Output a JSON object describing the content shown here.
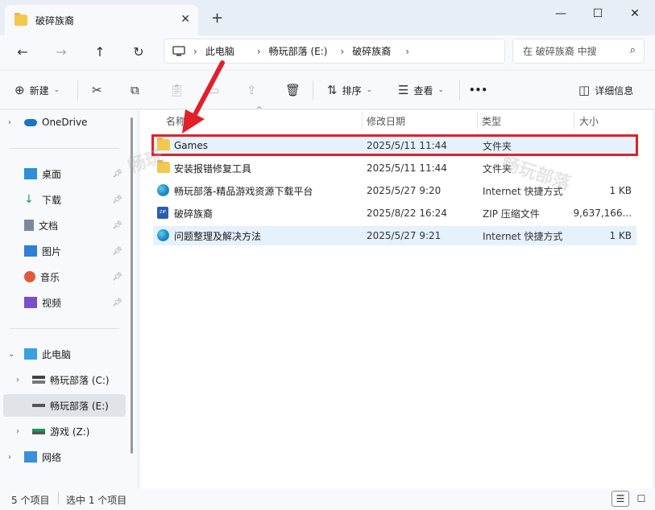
{
  "window": {
    "tab_title": "破碎族裔",
    "tab_close": "✕",
    "new_tab": "+",
    "minimize": "—",
    "maximize": "☐",
    "close": "✕"
  },
  "address": {
    "crumbs": [
      "此电脑",
      "畅玩部落 (E:)",
      "破碎族裔"
    ],
    "search_placeholder": "在 破碎族裔 中搜"
  },
  "toolbar": {
    "new_label": "新建",
    "sort_label": "排序",
    "view_label": "查看",
    "more_label": "•••",
    "details_label": "详细信息"
  },
  "sidebar": {
    "onedrive": "OneDrive",
    "quick": [
      {
        "label": "桌面",
        "icon": "desktop-icon",
        "color": "#2f8fd8"
      },
      {
        "label": "下载",
        "icon": "download-icon",
        "color": "#1a9b5a"
      },
      {
        "label": "文档",
        "icon": "document-icon",
        "color": "#7a8a9a"
      },
      {
        "label": "图片",
        "icon": "picture-icon",
        "color": "#2f7fd8"
      },
      {
        "label": "音乐",
        "icon": "music-icon",
        "color": "#e05a3a"
      },
      {
        "label": "视频",
        "icon": "video-icon",
        "color": "#7a4fc8"
      }
    ],
    "this_pc": "此电脑",
    "drives": [
      {
        "label": "畅玩部落 (C:)",
        "selected": false
      },
      {
        "label": "畅玩部落 (E:)",
        "selected": true
      },
      {
        "label": "游戏 (Z:)",
        "selected": false
      }
    ],
    "network": "网络"
  },
  "columns": {
    "name": "名称",
    "date": "修改日期",
    "type": "类型",
    "size": "大小"
  },
  "files": [
    {
      "name": "Games",
      "date": "2025/5/11 11:44",
      "type": "文件夹",
      "size": "",
      "icon": "folder-icon",
      "highlighted": true
    },
    {
      "name": "安装报错修复工具",
      "date": "2025/5/11 11:44",
      "type": "文件夹",
      "size": "",
      "icon": "folder-icon",
      "highlighted": false
    },
    {
      "name": "畅玩部落-精品游戏资源下载平台",
      "date": "2025/5/27 9:20",
      "type": "Internet 快捷方式",
      "size": "1 KB",
      "icon": "web-shortcut-icon",
      "highlighted": false
    },
    {
      "name": "破碎族裔",
      "date": "2025/8/22 16:24",
      "type": "ZIP 压缩文件",
      "size": "9,637,166...",
      "icon": "zip-icon",
      "highlighted": false
    },
    {
      "name": "问题整理及解决方法",
      "date": "2025/5/27 9:21",
      "type": "Internet 快捷方式",
      "size": "1 KB",
      "icon": "web-shortcut-icon",
      "highlighted": true
    }
  ],
  "watermarks": [
    "畅玩",
    "畅玩部落"
  ],
  "status": {
    "count": "5 个项目",
    "selected": "选中 1 个项目"
  },
  "colors": {
    "annotation_red": "#e0202a",
    "folder": "#f2c94c",
    "selection": "#e5f1fb"
  }
}
